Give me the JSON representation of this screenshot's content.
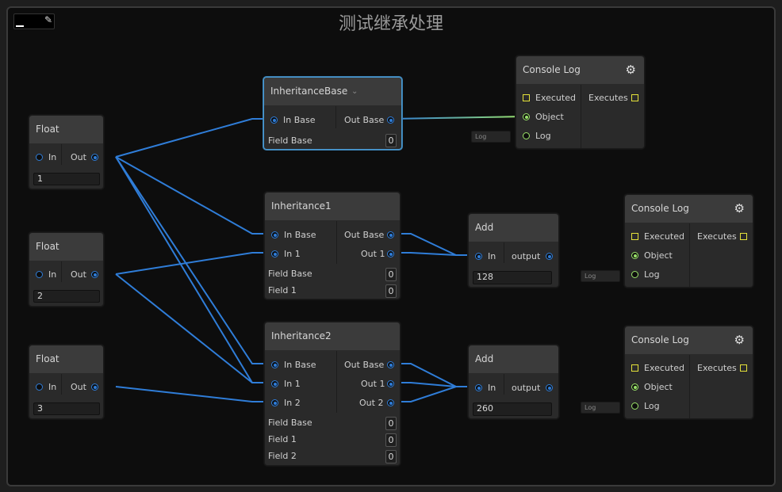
{
  "graph": {
    "title": "测试继承处理"
  },
  "colors": {
    "wire_blue": "#2f7dd8",
    "wire_green": "#9be36a",
    "exec_yellow": "#e5e23a",
    "selection": "#4a9ad2"
  },
  "float_nodes": [
    {
      "title": "Float",
      "in": "In",
      "out": "Out",
      "value": "1"
    },
    {
      "title": "Float",
      "in": "In",
      "out": "Out",
      "value": "2"
    },
    {
      "title": "Float",
      "in": "In",
      "out": "Out",
      "value": "3"
    }
  ],
  "inheritance_base": {
    "title": "InheritanceBase",
    "in_base": "In Base",
    "out_base": "Out Base",
    "field_base": "Field Base",
    "field_base_value": "0"
  },
  "inheritance1": {
    "title": "Inheritance1",
    "in_base": "In Base",
    "in_1": "In 1",
    "out_base": "Out Base",
    "out_1": "Out 1",
    "field_base": "Field Base",
    "field_base_value": "0",
    "field_1": "Field 1",
    "field_1_value": "0"
  },
  "inheritance2": {
    "title": "Inheritance2",
    "in_base": "In Base",
    "in_1": "In 1",
    "in_2": "In 2",
    "out_base": "Out Base",
    "out_1": "Out 1",
    "out_2": "Out 2",
    "field_base": "Field Base",
    "field_base_value": "0",
    "field_1": "Field 1",
    "field_1_value": "0",
    "field_2": "Field 2",
    "field_2_value": "0"
  },
  "add_nodes": [
    {
      "title": "Add",
      "in": "In",
      "out": "output",
      "value": "128"
    },
    {
      "title": "Add",
      "in": "In",
      "out": "output",
      "value": "260"
    }
  ],
  "console_nodes": [
    {
      "title": "Console Log",
      "executed": "Executed",
      "executes": "Executes",
      "object": "Object",
      "log": "Log",
      "log_placeholder": "Log"
    },
    {
      "title": "Console Log",
      "executed": "Executed",
      "executes": "Executes",
      "object": "Object",
      "log": "Log",
      "log_placeholder": "Log"
    },
    {
      "title": "Console Log",
      "executed": "Executed",
      "executes": "Executes",
      "object": "Object",
      "log": "Log",
      "log_placeholder": "Log"
    }
  ]
}
